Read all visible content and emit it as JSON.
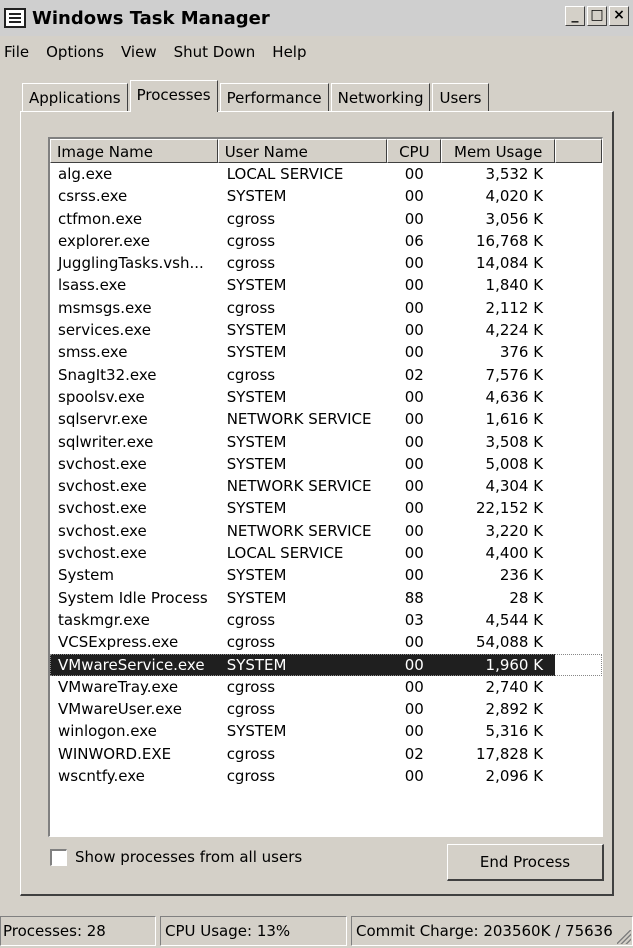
{
  "window": {
    "title": "Windows Task Manager",
    "buttons": {
      "minimize": "_",
      "maximize": "□",
      "close": "×"
    }
  },
  "menu": [
    "File",
    "Options",
    "View",
    "Shut Down",
    "Help"
  ],
  "tabs": [
    {
      "label": "Applications",
      "active": false
    },
    {
      "label": "Processes",
      "active": true
    },
    {
      "label": "Performance",
      "active": false
    },
    {
      "label": "Networking",
      "active": false
    },
    {
      "label": "Users",
      "active": false
    }
  ],
  "columns": [
    "Image Name",
    "User Name",
    "CPU",
    "Mem Usage"
  ],
  "processes": [
    {
      "image": "alg.exe",
      "user": "LOCAL SERVICE",
      "cpu": "00",
      "mem": "3,532 K"
    },
    {
      "image": "csrss.exe",
      "user": "SYSTEM",
      "cpu": "00",
      "mem": "4,020 K"
    },
    {
      "image": "ctfmon.exe",
      "user": "cgross",
      "cpu": "00",
      "mem": "3,056 K"
    },
    {
      "image": "explorer.exe",
      "user": "cgross",
      "cpu": "06",
      "mem": "16,768 K"
    },
    {
      "image": "JugglingTasks.vsh...",
      "user": "cgross",
      "cpu": "00",
      "mem": "14,084 K"
    },
    {
      "image": "lsass.exe",
      "user": "SYSTEM",
      "cpu": "00",
      "mem": "1,840 K"
    },
    {
      "image": "msmsgs.exe",
      "user": "cgross",
      "cpu": "00",
      "mem": "2,112 K"
    },
    {
      "image": "services.exe",
      "user": "SYSTEM",
      "cpu": "00",
      "mem": "4,224 K"
    },
    {
      "image": "smss.exe",
      "user": "SYSTEM",
      "cpu": "00",
      "mem": "376 K"
    },
    {
      "image": "SnagIt32.exe",
      "user": "cgross",
      "cpu": "02",
      "mem": "7,576 K"
    },
    {
      "image": "spoolsv.exe",
      "user": "SYSTEM",
      "cpu": "00",
      "mem": "4,636 K"
    },
    {
      "image": "sqlservr.exe",
      "user": "NETWORK SERVICE",
      "cpu": "00",
      "mem": "1,616 K"
    },
    {
      "image": "sqlwriter.exe",
      "user": "SYSTEM",
      "cpu": "00",
      "mem": "3,508 K"
    },
    {
      "image": "svchost.exe",
      "user": "SYSTEM",
      "cpu": "00",
      "mem": "5,008 K"
    },
    {
      "image": "svchost.exe",
      "user": "NETWORK SERVICE",
      "cpu": "00",
      "mem": "4,304 K"
    },
    {
      "image": "svchost.exe",
      "user": "SYSTEM",
      "cpu": "00",
      "mem": "22,152 K"
    },
    {
      "image": "svchost.exe",
      "user": "NETWORK SERVICE",
      "cpu": "00",
      "mem": "3,220 K"
    },
    {
      "image": "svchost.exe",
      "user": "LOCAL SERVICE",
      "cpu": "00",
      "mem": "4,400 K"
    },
    {
      "image": "System",
      "user": "SYSTEM",
      "cpu": "00",
      "mem": "236 K"
    },
    {
      "image": "System Idle Process",
      "user": "SYSTEM",
      "cpu": "88",
      "mem": "28 K"
    },
    {
      "image": "taskmgr.exe",
      "user": "cgross",
      "cpu": "03",
      "mem": "4,544 K"
    },
    {
      "image": "VCSExpress.exe",
      "user": "cgross",
      "cpu": "00",
      "mem": "54,088 K"
    },
    {
      "image": "VMwareService.exe",
      "user": "SYSTEM",
      "cpu": "00",
      "mem": "1,960 K",
      "selected": true
    },
    {
      "image": "VMwareTray.exe",
      "user": "cgross",
      "cpu": "00",
      "mem": "2,740 K"
    },
    {
      "image": "VMwareUser.exe",
      "user": "cgross",
      "cpu": "00",
      "mem": "2,892 K"
    },
    {
      "image": "winlogon.exe",
      "user": "SYSTEM",
      "cpu": "00",
      "mem": "5,316 K"
    },
    {
      "image": "WINWORD.EXE",
      "user": "cgross",
      "cpu": "02",
      "mem": "17,828 K"
    },
    {
      "image": "wscntfy.exe",
      "user": "cgross",
      "cpu": "00",
      "mem": "2,096 K"
    }
  ],
  "options": {
    "show_all_users_label": "Show processes from all users",
    "show_all_users_checked": false
  },
  "actions": {
    "end_process": "End Process"
  },
  "status": {
    "processes": "Processes: 28",
    "cpu_usage": "CPU Usage: 13%",
    "commit_charge": "Commit Charge: 203560K / 75636"
  }
}
